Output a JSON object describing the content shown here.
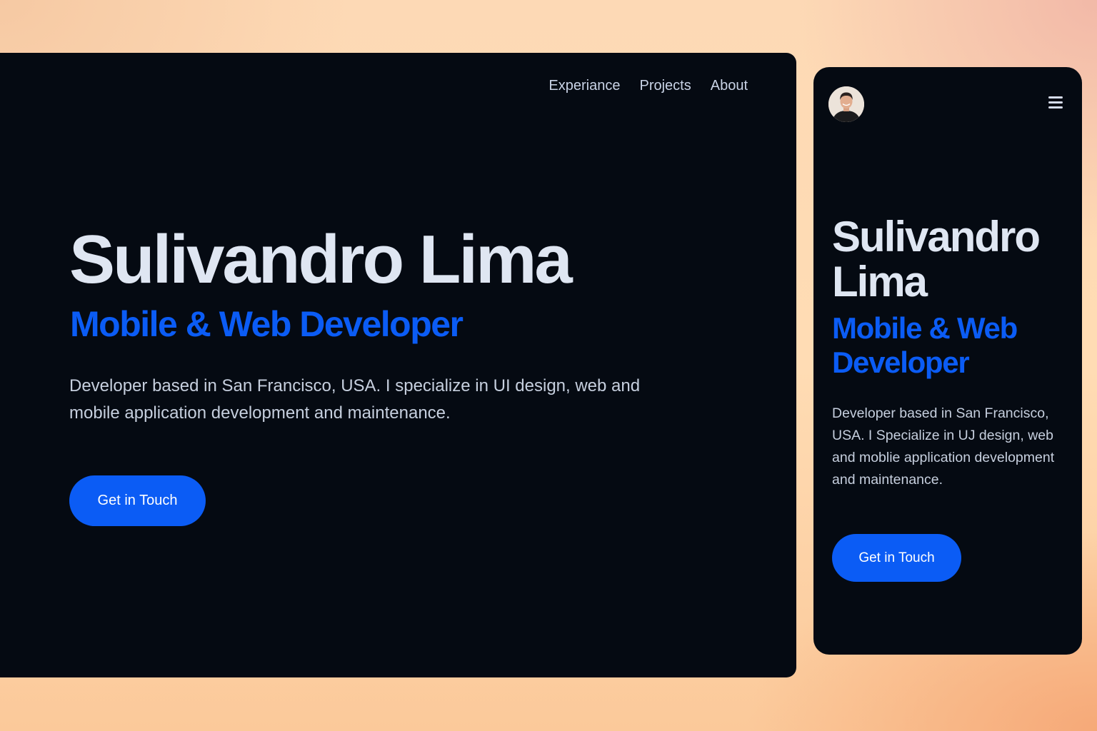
{
  "desktop": {
    "nav": {
      "experience": "Experiance",
      "projects": "Projects",
      "about": "About"
    },
    "name": "Sulivandro Lima",
    "role": "Mobile & Web Developer",
    "bio": "Developer based in San Francisco, USA. I specialize in UI design, web and mobile application development and maintenance.",
    "cta": "Get in Touch"
  },
  "mobile": {
    "avatar_icon": "profile-photo",
    "menu_icon": "hamburger-menu-icon",
    "name": "Sulivandro Lima",
    "role": "Mobile & Web Developer",
    "bio": "Developer based in San Francisco, USA. I Specialize in UJ design, web and moblie application development and maintenance.",
    "cta": "Get in Touch"
  },
  "colors": {
    "card_background": "#050a12",
    "accent": "#0b5cf5",
    "heading": "#dfe6f2",
    "body_text": "#c6cfde"
  }
}
